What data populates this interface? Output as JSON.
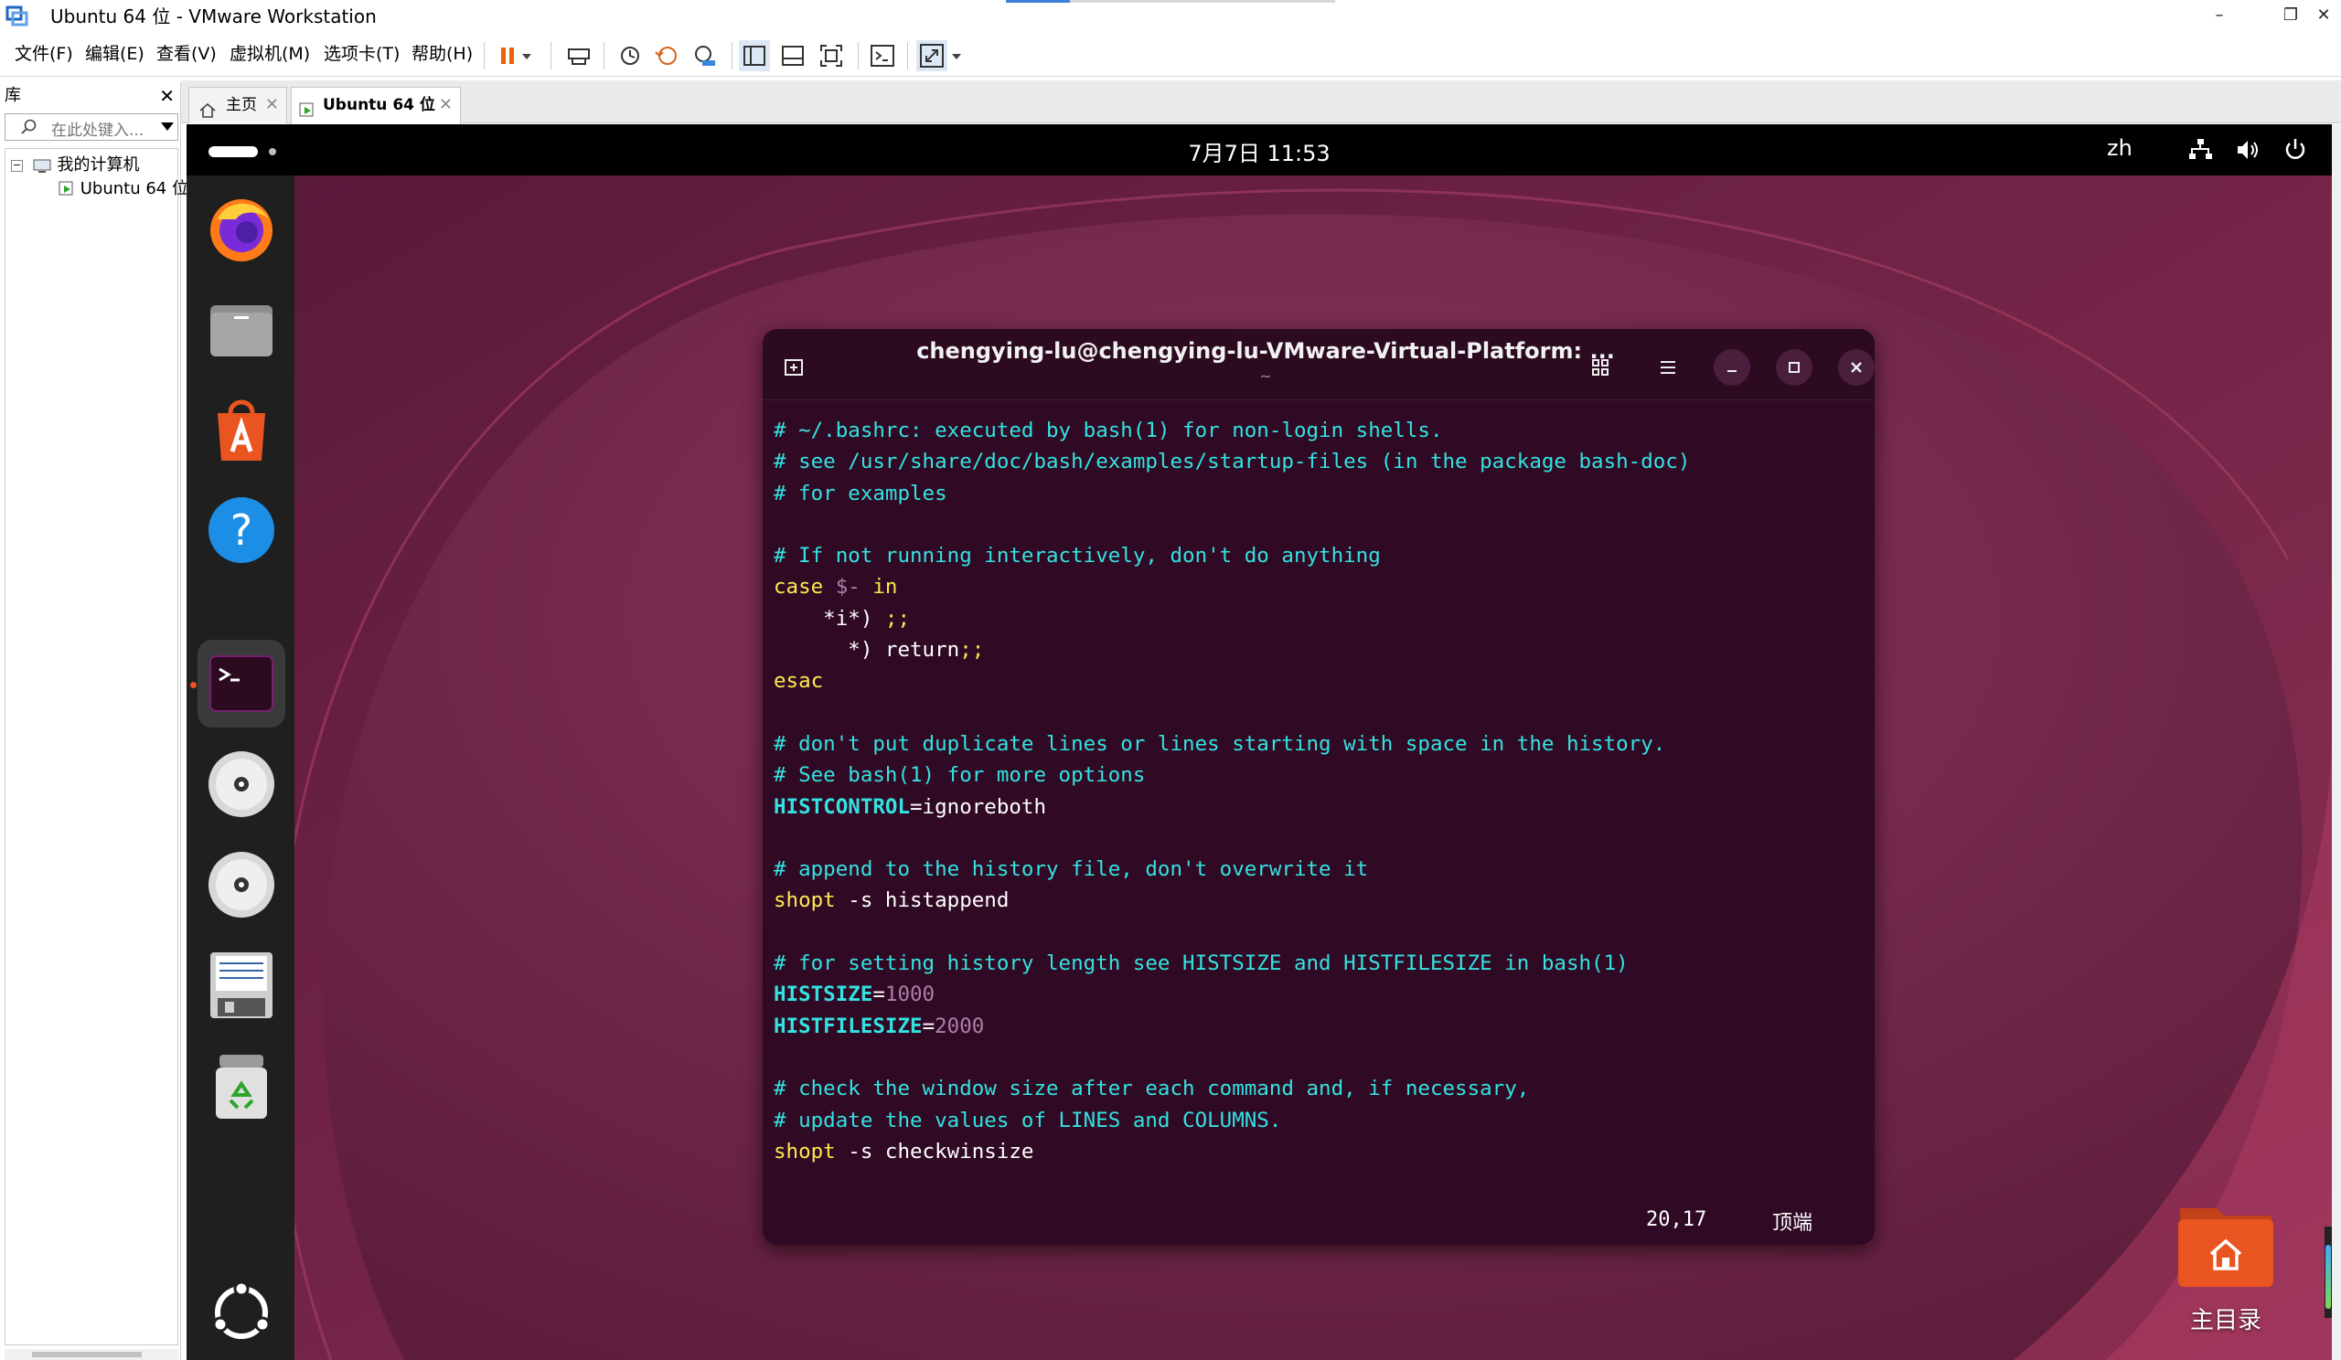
{
  "window": {
    "title": "Ubuntu 64 位 - VMware Workstation",
    "minimize": "–",
    "restore": "❐",
    "close": "✕"
  },
  "menu": {
    "items": [
      "文件(F)",
      "编辑(E)",
      "查看(V)",
      "虚拟机(M)",
      "选项卡(T)",
      "帮助(H)"
    ]
  },
  "toolbar": {
    "icons": [
      "pause-icon",
      "dropdown-arrow-icon",
      "send-ctrl-alt-del-icon",
      "snapshot-icon",
      "revert-snapshot-icon",
      "snapshot-manager-icon",
      "library-view-icon",
      "thumbnail-view-icon",
      "fullscreen-icon",
      "console-view-icon",
      "stretch-icon",
      "dropdown-arrow-icon"
    ]
  },
  "library": {
    "title": "库",
    "close": "✕",
    "search_placeholder": "在此处键入...",
    "tree": {
      "root": "我的计算机",
      "child": "Ubuntu 64 位"
    }
  },
  "tabs": [
    {
      "label": "主页",
      "close": "✕"
    },
    {
      "label": "Ubuntu 64 位",
      "close": "✕"
    }
  ],
  "guest": {
    "clock": "7月7日  11:53",
    "lang": "zh",
    "dock_icons": [
      "firefox-icon",
      "files-icon",
      "app-center-icon",
      "help-icon",
      "terminal-icon",
      "cd-drive-icon",
      "cd-drive-icon",
      "floppy-drive-icon",
      "trash-icon",
      "show-apps-icon"
    ],
    "home_folder_label": "主目录",
    "colors": {
      "wallpaper": "#7d2a4e",
      "terminal_bg": "#300a24",
      "accent": "#e95420"
    }
  },
  "terminal": {
    "title": "chengying-lu@chengying-lu-VMware-Virtual-Platform: ...",
    "subtitle": "~",
    "lines": [
      [
        {
          "t": "# ~/.bashrc: executed by bash(1) for non-login shells.",
          "c": "comment"
        }
      ],
      [
        {
          "t": "# see /usr/share/doc/bash/examples/startup-files (in the package bash-doc)",
          "c": "comment"
        }
      ],
      [
        {
          "t": "# for examples",
          "c": "comment"
        }
      ],
      [],
      [
        {
          "t": "# If not running interactively, don't do anything",
          "c": "comment"
        }
      ],
      [
        {
          "t": "case",
          "c": "kw"
        },
        {
          "t": " ",
          "c": "txt"
        },
        {
          "t": "$-",
          "c": "str"
        },
        {
          "t": " ",
          "c": "txt"
        },
        {
          "t": "in",
          "c": "kw"
        }
      ],
      [
        {
          "t": "    *i*) ",
          "c": "txt"
        },
        {
          "t": ";;",
          "c": "kw"
        }
      ],
      [
        {
          "t": "      *) return",
          "c": "txt"
        },
        {
          "t": ";;",
          "c": "kw"
        }
      ],
      [
        {
          "t": "esac",
          "c": "kw"
        }
      ],
      [],
      [
        {
          "t": "# don't put duplicate lines or lines starting with space in the history.",
          "c": "comment"
        }
      ],
      [
        {
          "t": "# See bash(1) for more options",
          "c": "comment"
        }
      ],
      [
        {
          "t": "HISTCONTROL",
          "c": "var"
        },
        {
          "t": "=ignoreboth",
          "c": "txt"
        }
      ],
      [],
      [
        {
          "t": "# append to the history file, don't overwrite it",
          "c": "comment"
        }
      ],
      [
        {
          "t": "shopt",
          "c": "kw"
        },
        {
          "t": " -s histappend",
          "c": "txt"
        }
      ],
      [],
      [
        {
          "t": "# for setting history length see HISTSIZE and HISTFILESIZE in bash(1)",
          "c": "comment"
        }
      ],
      [
        {
          "t": "HISTSIZE",
          "c": "var"
        },
        {
          "t": "=",
          "c": "txt"
        },
        {
          "t": "1000",
          "c": "num"
        }
      ],
      [
        {
          "t": "HISTFILESIZE",
          "c": "var"
        },
        {
          "t": "=",
          "c": "txt"
        },
        {
          "t": "2000",
          "c": "num"
        }
      ],
      [],
      [
        {
          "t": "# check the window size after each command and, if necessary,",
          "c": "comment"
        }
      ],
      [
        {
          "t": "# update the values of LINES and COLUMNS.",
          "c": "comment"
        }
      ],
      [
        {
          "t": "shopt",
          "c": "kw"
        },
        {
          "t": " -s checkwinsize",
          "c": "txt"
        }
      ]
    ],
    "status": {
      "position": "20,17",
      "where": "顶端"
    }
  }
}
